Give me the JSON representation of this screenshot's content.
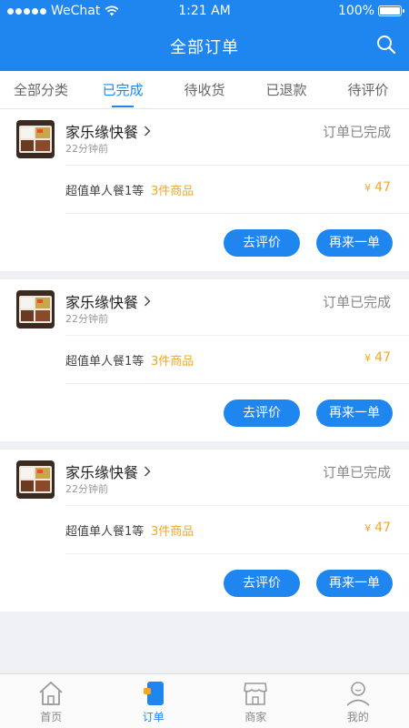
{
  "status_bar": {
    "carrier": "WeChat",
    "time": "1:21 AM",
    "battery": "100%"
  },
  "header": {
    "title": "全部订单",
    "search_icon": "search-icon"
  },
  "tabs": [
    {
      "label": "全部分类",
      "active": false
    },
    {
      "label": "已完成",
      "active": true
    },
    {
      "label": "待收货",
      "active": false
    },
    {
      "label": "已退款",
      "active": false
    },
    {
      "label": "待评价",
      "active": false
    }
  ],
  "orders": [
    {
      "shop": "家乐缘快餐",
      "time_ago": "22分钟前",
      "status": "订单已完成",
      "item": "超值单人餐1等",
      "count": "3件商品",
      "currency": "¥",
      "price": "47",
      "review_label": "去评价",
      "reorder_label": "再来一单"
    },
    {
      "shop": "家乐缘快餐",
      "time_ago": "22分钟前",
      "status": "订单已完成",
      "item": "超值单人餐1等",
      "count": "3件商品",
      "currency": "¥",
      "price": "47",
      "review_label": "去评价",
      "reorder_label": "再来一单"
    },
    {
      "shop": "家乐缘快餐",
      "time_ago": "22分钟前",
      "status": "订单已完成",
      "item": "超值单人餐1等",
      "count": "3件商品",
      "currency": "¥",
      "price": "47",
      "review_label": "去评价",
      "reorder_label": "再来一单"
    }
  ],
  "tabbar": [
    {
      "label": "首页",
      "icon": "home-icon",
      "active": false
    },
    {
      "label": "订单",
      "icon": "orders-icon",
      "active": true
    },
    {
      "label": "商家",
      "icon": "shop-icon",
      "active": false
    },
    {
      "label": "我的",
      "icon": "profile-icon",
      "active": false
    }
  ],
  "colors": {
    "primary": "#1f86f0",
    "accent": "#f5a623",
    "background": "#eef0f3"
  }
}
